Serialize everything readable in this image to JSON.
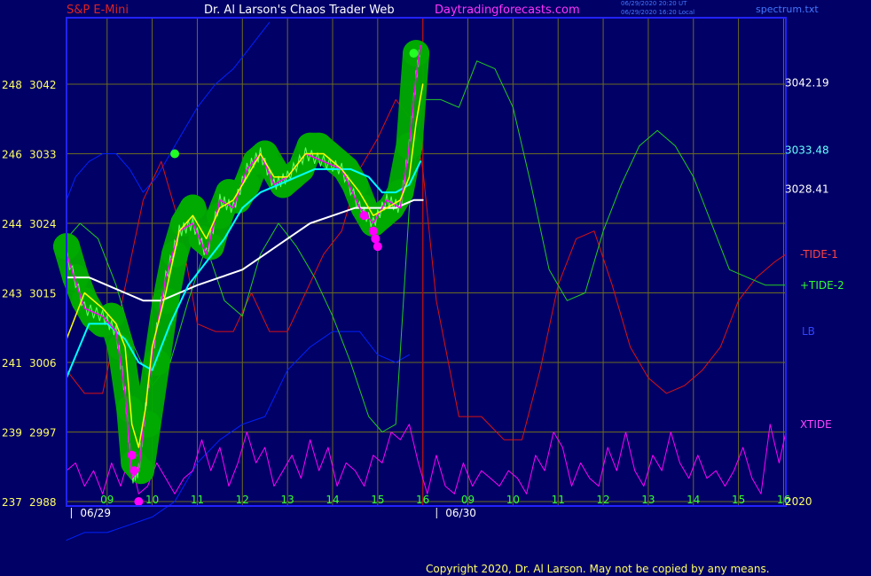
{
  "header": {
    "symbol": "S&P E-Mini",
    "title": "Dr. Al Larson's Chaos Trader Web",
    "site": "Daytradingforecasts.com",
    "stamp1": "06/29/2020 20:20 UT",
    "stamp2": "06/29/2020 16:20 Local",
    "file": "spectrum.txt"
  },
  "copyright": "Copyright 2020, Dr. Al Larson. May not be copied by any means.",
  "colors": {
    "background": "#000066",
    "frame": "#2222ff",
    "grid": "#6b6b22",
    "price": "#ff00ff",
    "band": "#00aa00",
    "ma_fast": "#ffff00",
    "ma_mid": "#00ffff",
    "ma_slow": "#ffffff",
    "tide1": "#dd1111",
    "tide2": "#22cc22",
    "lb": "#0022ff",
    "xtide": "#ff00ff"
  },
  "chart_data": {
    "type": "line",
    "y_ticks_price": [
      "3042",
      "3033",
      "3024",
      "3015",
      "3006",
      "2997",
      "2988"
    ],
    "y_ticks_alt": [
      "248",
      "246",
      "244",
      "243",
      "241",
      "239",
      "237"
    ],
    "ylim": [
      2988,
      3042
    ],
    "x_ticks": [
      "09",
      "10",
      "11",
      "12",
      "13",
      "14",
      "15",
      "16",
      "09",
      "10",
      "11",
      "12",
      "13",
      "14",
      "15",
      "16"
    ],
    "x_positions": [
      9,
      10,
      11,
      12,
      13,
      14,
      15,
      16,
      17,
      18,
      19,
      20,
      21,
      22,
      23,
      24
    ],
    "xlim": [
      8.1,
      24.05
    ],
    "dates": [
      {
        "label": "06/29",
        "x": 8.6
      },
      {
        "label": "06/30",
        "x": 16.7
      }
    ],
    "right_labels": [
      {
        "text": "3042.19",
        "y": 3042.19,
        "color": "#ffffff"
      },
      {
        "text": "3033.48",
        "y": 3033.48,
        "color": "#66ffff"
      },
      {
        "text": "3028.41",
        "y": 3028.41,
        "color": "#ffffff"
      },
      {
        "text": "-TIDE-1",
        "y": 3020,
        "color": "#ff4444"
      },
      {
        "text": "+TIDE-2",
        "y": 3016,
        "color": "#33ff33"
      },
      {
        "text": "LB",
        "y": 3010,
        "color": "#3344ff"
      },
      {
        "text": "XTIDE",
        "y": 2998,
        "color": "#ff44ff"
      },
      {
        "text": "2020",
        "y": 2988,
        "color": "#ffff66"
      }
    ],
    "price": {
      "x": [
        8.1,
        8.5,
        8.9,
        9.2,
        9.4,
        9.55,
        9.7,
        9.85,
        10.0,
        10.3,
        10.6,
        10.9,
        11.2,
        11.5,
        11.8,
        12.1,
        12.4,
        12.7,
        13.0,
        13.4,
        13.8,
        14.2,
        14.6,
        14.9,
        15.2,
        15.5,
        15.7,
        15.85,
        15.95
      ],
      "values": [
        3020,
        3013,
        3012,
        3010,
        3002,
        2991,
        2992,
        3000,
        3007,
        3017,
        3023,
        3024,
        3020,
        3027,
        3026,
        3031,
        3033,
        3029,
        3030,
        3033,
        3032,
        3031,
        3026,
        3024,
        3027,
        3026,
        3034,
        3043,
        3047
      ]
    },
    "ma_fast": {
      "x": [
        8.1,
        8.5,
        8.9,
        9.2,
        9.4,
        9.55,
        9.7,
        9.85,
        10.0,
        10.3,
        10.6,
        10.9,
        11.2,
        11.5,
        11.8,
        12.1,
        12.4,
        12.7,
        13.0,
        13.4,
        13.8,
        14.2,
        14.6,
        14.9,
        15.2,
        15.5,
        15.7,
        15.85,
        16.0
      ],
      "values": [
        3009,
        3015,
        3013,
        3011,
        3008,
        2998,
        2995,
        3000,
        3008,
        3015,
        3023,
        3025,
        3022,
        3026,
        3027,
        3030,
        3033,
        3030,
        3030,
        3033,
        3033,
        3031,
        3028,
        3025,
        3026,
        3027,
        3030,
        3037,
        3042
      ]
    },
    "ma_mid": {
      "x": [
        8.1,
        8.6,
        9.0,
        9.4,
        9.7,
        10.0,
        10.4,
        10.8,
        11.2,
        11.6,
        12.0,
        12.4,
        12.8,
        13.2,
        13.6,
        14.0,
        14.4,
        14.8,
        15.1,
        15.4,
        15.7,
        15.95
      ],
      "values": [
        3004,
        3011,
        3011,
        3009,
        3006,
        3005,
        3011,
        3016,
        3019,
        3022,
        3026,
        3028,
        3029,
        3030,
        3031,
        3031,
        3031,
        3030,
        3028,
        3028,
        3029,
        3032
      ]
    },
    "ma_slow": {
      "x": [
        8.1,
        8.6,
        9.0,
        9.4,
        9.8,
        10.2,
        10.6,
        11.0,
        11.5,
        12.0,
        12.5,
        13.0,
        13.5,
        14.0,
        14.5,
        15.0,
        15.4,
        15.8,
        16.0
      ],
      "values": [
        3017,
        3017,
        3016,
        3015,
        3014,
        3014,
        3015,
        3016,
        3017,
        3018,
        3020,
        3022,
        3024,
        3025,
        3026,
        3026,
        3026,
        3027,
        3027
      ]
    },
    "band": {
      "x": [
        8.1,
        8.3,
        8.5,
        8.7,
        8.9,
        9.1,
        9.3,
        9.5,
        9.6,
        9.75,
        9.9,
        10.1,
        10.3,
        10.5,
        10.7,
        10.9,
        11.1,
        11.3,
        11.5,
        11.7,
        11.9,
        12.1,
        12.3,
        12.5,
        12.7,
        12.9,
        13.1,
        13.3,
        13.5,
        13.7,
        13.9,
        14.1,
        14.3,
        14.5,
        14.7,
        14.9,
        15.1,
        15.3,
        15.5,
        15.7,
        15.85
      ],
      "values": [
        3021,
        3017,
        3014,
        3012,
        3011,
        3012,
        3008,
        3000,
        2993,
        2992,
        2998,
        3006,
        3014,
        3020,
        3024,
        3026,
        3022,
        3021,
        3025,
        3028,
        3027,
        3029,
        3032,
        3033,
        3031,
        3029,
        3030,
        3031,
        3034,
        3034,
        3033,
        3032,
        3031,
        3029,
        3026,
        3024,
        3025,
        3026,
        3028,
        3034,
        3046
      ]
    },
    "magenta_dots": {
      "x": [
        9.55,
        9.6,
        9.7,
        14.7,
        14.9,
        14.95,
        15.0
      ],
      "values": [
        2994,
        2992,
        2988,
        3025,
        3023,
        3022,
        3021
      ]
    },
    "green_dots": {
      "x": [
        10.5,
        15.8
      ],
      "values": [
        3033,
        3046
      ]
    },
    "tide1": {
      "x": [
        8.1,
        8.5,
        8.9,
        9.3,
        9.8,
        10.2,
        10.6,
        11.0,
        11.4,
        11.8,
        12.2,
        12.6,
        13.0,
        13.4,
        13.8,
        14.2,
        14.6,
        15.0,
        15.4,
        15.8,
        16.0,
        16.3,
        16.8,
        17.3,
        17.8,
        18.2,
        18.6,
        19.0,
        19.4,
        19.8,
        20.2,
        20.6,
        21.0,
        21.4,
        21.8,
        22.2,
        22.6,
        23.0,
        23.4,
        23.8,
        24.05
      ],
      "values": [
        3005,
        3002,
        3002,
        3013,
        3027,
        3032,
        3024,
        3011,
        3010,
        3010,
        3015,
        3010,
        3010,
        3015,
        3020,
        3023,
        3031,
        3035,
        3040,
        3037,
        3031,
        3014,
        2999,
        2999,
        2996,
        2996,
        3005,
        3016,
        3022,
        3023,
        3016,
        3008,
        3004,
        3002,
        3003,
        3005,
        3008,
        3014,
        3017,
        3019,
        3020
      ]
    },
    "tide2": {
      "x": [
        8.1,
        8.4,
        8.8,
        9.2,
        9.6,
        10.0,
        10.4,
        10.8,
        11.2,
        11.6,
        12.0,
        12.4,
        12.8,
        13.2,
        13.6,
        14.0,
        14.4,
        14.8,
        15.1,
        15.4,
        15.7,
        16.0,
        16.4,
        16.8,
        17.2,
        17.6,
        18.0,
        18.4,
        18.8,
        19.2,
        19.6,
        20.0,
        20.4,
        20.8,
        21.2,
        21.6,
        22.0,
        22.4,
        22.8,
        23.2,
        23.6,
        24.05
      ],
      "values": [
        3022,
        3024,
        3022,
        3016,
        3008,
        3003,
        3006,
        3014,
        3021,
        3014,
        3012,
        3020,
        3024,
        3021,
        3017,
        3012,
        3006,
        2999,
        2997,
        2998,
        3026,
        3040,
        3040,
        3039,
        3045,
        3044,
        3039,
        3029,
        3018,
        3014,
        3015,
        3023,
        3029,
        3034,
        3036,
        3034,
        3030,
        3024,
        3018,
        3017,
        3016,
        3016
      ]
    },
    "lb": {
      "x": [
        8.1,
        8.5,
        9.0,
        9.5,
        10.0,
        10.5,
        11.0,
        11.5,
        12.0,
        12.5,
        13.0,
        13.5,
        14.0,
        14.3,
        14.6,
        15.0,
        15.4,
        15.7
      ],
      "values": [
        2983,
        2984,
        2984,
        2985,
        2986,
        2988,
        2993,
        2996,
        2998,
        2999,
        3005,
        3008,
        3010,
        3010,
        3010,
        3007,
        3006,
        3007
      ]
    },
    "ub": {
      "x": [
        8.1,
        8.3,
        8.6,
        8.9,
        9.2,
        9.5,
        9.8,
        10.1,
        10.5,
        11.0,
        11.4,
        11.8,
        12.2,
        12.6
      ],
      "values": [
        3027,
        3030,
        3032,
        3033,
        3033,
        3031,
        3028,
        3030,
        3034,
        3039,
        3042,
        3044,
        3047,
        3050
      ]
    },
    "xtide": {
      "x": [
        8.1,
        8.3,
        8.5,
        8.7,
        8.9,
        9.1,
        9.3,
        9.5,
        9.7,
        9.9,
        10.1,
        10.3,
        10.5,
        10.7,
        10.9,
        11.1,
        11.3,
        11.5,
        11.7,
        11.9,
        12.1,
        12.3,
        12.5,
        12.7,
        12.9,
        13.1,
        13.3,
        13.5,
        13.7,
        13.9,
        14.1,
        14.3,
        14.5,
        14.7,
        14.9,
        15.1,
        15.3,
        15.5,
        15.7,
        15.9,
        16.1,
        16.3,
        16.5,
        16.7,
        16.9,
        17.1,
        17.3,
        17.5,
        17.7,
        17.9,
        18.1,
        18.3,
        18.5,
        18.7,
        18.9,
        19.1,
        19.3,
        19.5,
        19.7,
        19.9,
        20.1,
        20.3,
        20.5,
        20.7,
        20.9,
        21.1,
        21.3,
        21.5,
        21.7,
        21.9,
        22.1,
        22.3,
        22.5,
        22.7,
        22.9,
        23.1,
        23.3,
        23.5,
        23.7,
        23.9,
        24.05
      ],
      "values": [
        2992,
        2993,
        2990,
        2992,
        2989,
        2993,
        2990,
        2994,
        2989,
        2990,
        2993,
        2991,
        2989,
        2991,
        2992,
        2996,
        2992,
        2995,
        2990,
        2993,
        2997,
        2993,
        2995,
        2990,
        2992,
        2994,
        2991,
        2996,
        2992,
        2995,
        2990,
        2993,
        2992,
        2990,
        2994,
        2993,
        2997,
        2996,
        2998,
        2993,
        2989,
        2994,
        2990,
        2989,
        2993,
        2990,
        2992,
        2991,
        2990,
        2992,
        2991,
        2989,
        2994,
        2992,
        2997,
        2995,
        2990,
        2993,
        2991,
        2990,
        2995,
        2992,
        2997,
        2992,
        2990,
        2994,
        2992,
        2997,
        2993,
        2991,
        2994,
        2991,
        2992,
        2990,
        2992,
        2995,
        2991,
        2989,
        2998,
        2993,
        2997
      ]
    }
  }
}
